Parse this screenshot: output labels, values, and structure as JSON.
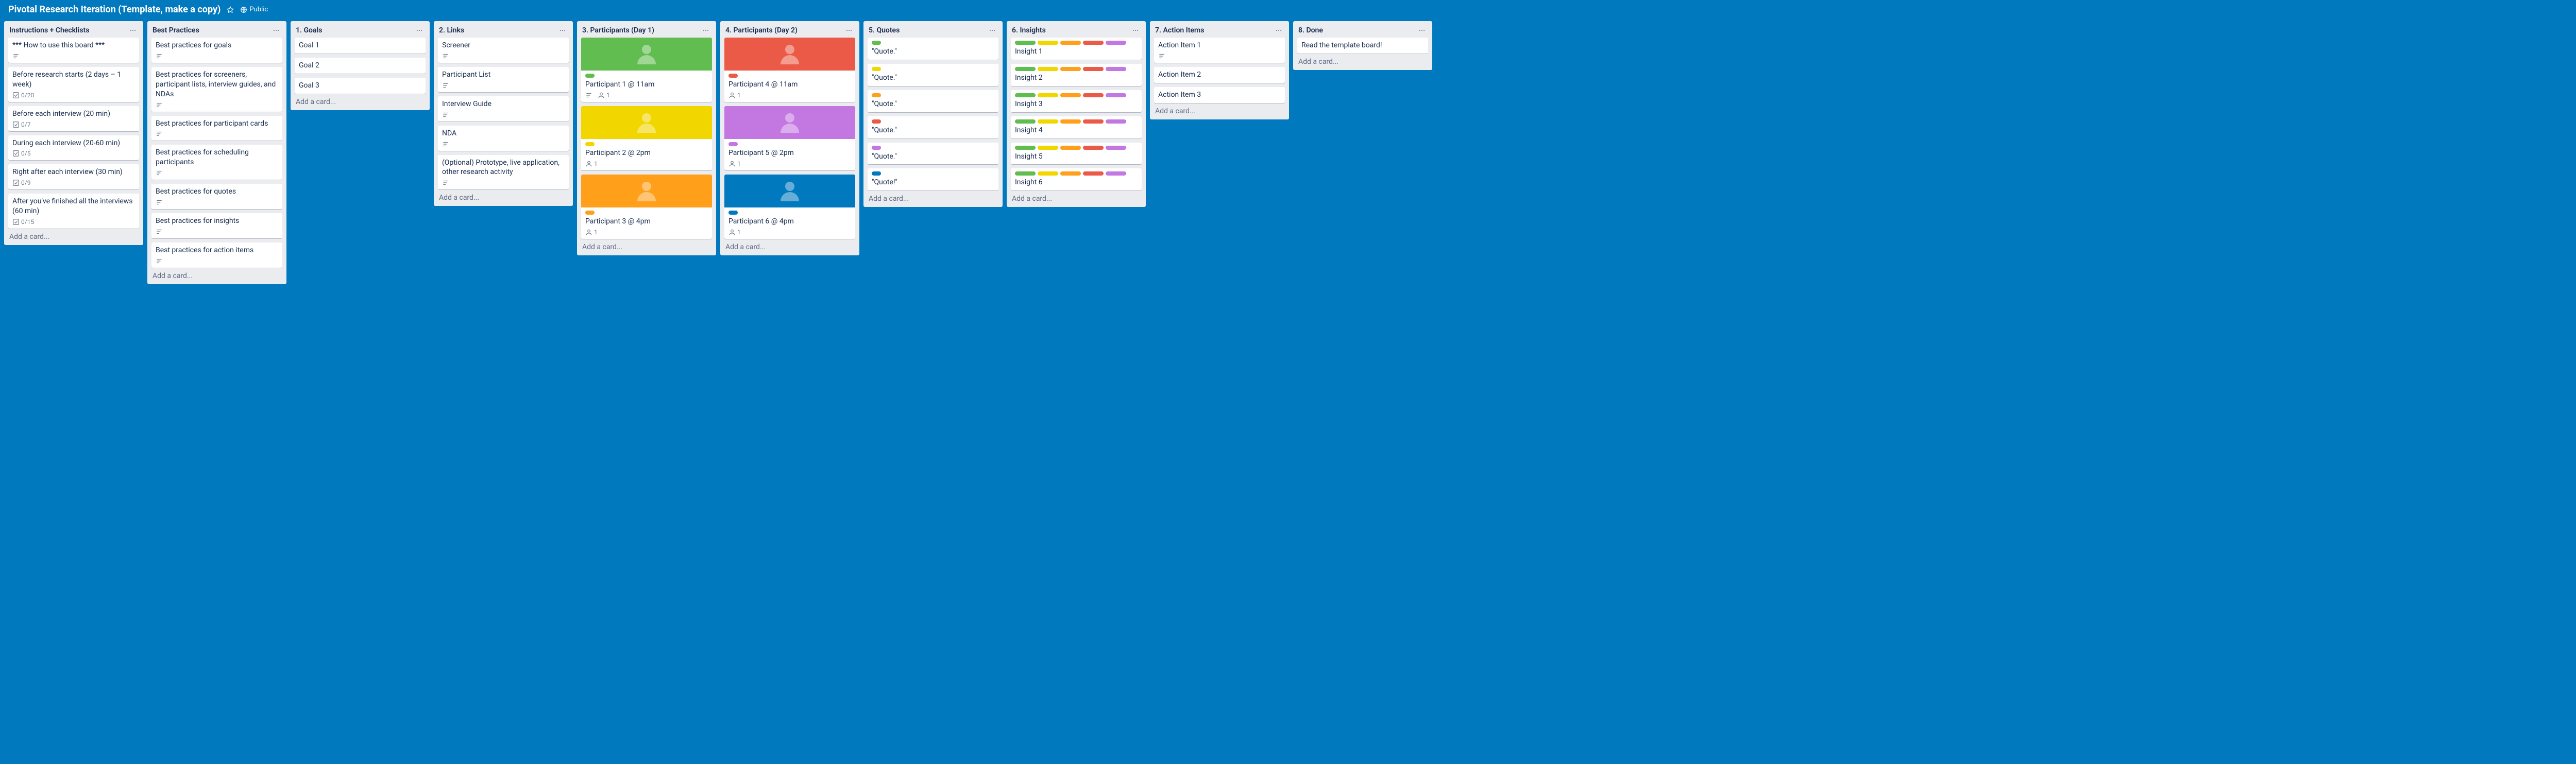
{
  "header": {
    "title": "Pivotal Research Iteration (Template, make a copy)",
    "visibility": "Public"
  },
  "addCardLabel": "Add a card...",
  "lists": [
    {
      "title": "Instructions + Checklists",
      "cards": [
        {
          "title": "*** How to use this board ***",
          "desc": true
        },
        {
          "title": "Before research starts (2 days – 1 week)",
          "checklist": "0/20"
        },
        {
          "title": "Before each interview (20 min)",
          "checklist": "0/7"
        },
        {
          "title": "During each interview (20-60 min)",
          "checklist": "0/5"
        },
        {
          "title": "Right after each interview (30 min)",
          "checklist": "0/9"
        },
        {
          "title": "After you've finished all the interviews (60 min)",
          "checklist": "0/15"
        }
      ]
    },
    {
      "title": "Best Practices",
      "cards": [
        {
          "title": "Best practices for goals",
          "desc": true
        },
        {
          "title": "Best practices for screeners, participant lists, interview guides, and NDAs",
          "desc": true
        },
        {
          "title": "Best practices for participant cards",
          "desc": true
        },
        {
          "title": "Best practices for scheduling participants",
          "desc": true
        },
        {
          "title": "Best practices for quotes",
          "desc": true
        },
        {
          "title": "Best practices for insights",
          "desc": true
        },
        {
          "title": "Best practices for action items",
          "desc": true
        }
      ]
    },
    {
      "title": "1. Goals",
      "cards": [
        {
          "title": "Goal 1"
        },
        {
          "title": "Goal 2"
        },
        {
          "title": "Goal 3"
        }
      ]
    },
    {
      "title": "2. Links",
      "cards": [
        {
          "title": "Screener",
          "desc": true
        },
        {
          "title": "Participant List",
          "desc": true
        },
        {
          "title": "Interview Guide",
          "desc": true
        },
        {
          "title": "NDA",
          "desc": true
        },
        {
          "title": "(Optional) Prototype, live application, other research activity",
          "desc": true
        }
      ]
    },
    {
      "title": "3. Participants (Day 1)",
      "cards": [
        {
          "cover": "c-green",
          "labels": [
            "c-green"
          ],
          "title": "Participant 1 @ 11am",
          "desc": true,
          "members": 1
        },
        {
          "cover": "c-yellow",
          "labels": [
            "c-yellow"
          ],
          "title": "Participant 2 @ 2pm",
          "members": 1
        },
        {
          "cover": "c-orange",
          "labels": [
            "c-orange"
          ],
          "title": "Participant 3 @ 4pm",
          "members": 1
        }
      ]
    },
    {
      "title": "4. Participants (Day 2)",
      "cards": [
        {
          "cover": "c-red",
          "labels": [
            "c-red"
          ],
          "title": "Participant 4 @ 11am",
          "members": 1
        },
        {
          "cover": "c-purple",
          "labels": [
            "c-purple"
          ],
          "title": "Participant 5 @ 2pm",
          "members": 1
        },
        {
          "cover": "c-blue",
          "labels": [
            "c-blue"
          ],
          "title": "Participant 6 @ 4pm",
          "members": 1
        }
      ]
    },
    {
      "title": "5. Quotes",
      "cards": [
        {
          "labels": [
            "c-green"
          ],
          "title": "\"Quote.\""
        },
        {
          "labels": [
            "c-yellow"
          ],
          "title": "\"Quote.\""
        },
        {
          "labels": [
            "c-orange"
          ],
          "title": "\"Quote.\""
        },
        {
          "labels": [
            "c-red"
          ],
          "title": "\"Quote.\""
        },
        {
          "labels": [
            "c-purple"
          ],
          "title": "\"Quote.\""
        },
        {
          "labels": [
            "c-blue"
          ],
          "title": "\"Quote!\""
        }
      ]
    },
    {
      "title": "6. Insights",
      "cards": [
        {
          "labels": [
            "c-green",
            "c-yellow",
            "c-orange",
            "c-red",
            "c-purple"
          ],
          "title": "Insight 1"
        },
        {
          "labels": [
            "c-green",
            "c-yellow",
            "c-orange",
            "c-red",
            "c-purple"
          ],
          "title": "Insight 2"
        },
        {
          "labels": [
            "c-green",
            "c-yellow",
            "c-orange",
            "c-red",
            "c-purple"
          ],
          "title": "Insight 3"
        },
        {
          "labels": [
            "c-green",
            "c-yellow",
            "c-orange",
            "c-red",
            "c-purple"
          ],
          "title": "Insight 4"
        },
        {
          "labels": [
            "c-green",
            "c-yellow",
            "c-orange",
            "c-red",
            "c-purple"
          ],
          "title": "Insight 5"
        },
        {
          "labels": [
            "c-green",
            "c-yellow",
            "c-orange",
            "c-red",
            "c-purple"
          ],
          "title": "Insight 6"
        }
      ]
    },
    {
      "title": "7. Action Items",
      "cards": [
        {
          "title": "Action Item 1",
          "desc": true
        },
        {
          "title": "Action Item 2"
        },
        {
          "title": "Action Item 3"
        }
      ]
    },
    {
      "title": "8. Done",
      "cards": [
        {
          "title": "Read the template board!"
        }
      ]
    }
  ]
}
